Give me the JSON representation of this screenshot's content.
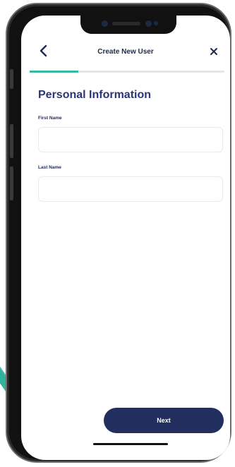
{
  "header": {
    "title": "Create New User",
    "back_icon": "chevron-left-icon",
    "close_icon": "close-icon"
  },
  "progress": {
    "step_fraction": 0.25
  },
  "form": {
    "section_title": "Personal Information",
    "first_name": {
      "label": "First Name",
      "value": "",
      "placeholder": ""
    },
    "last_name": {
      "label": "Last Name",
      "value": "",
      "placeholder": ""
    }
  },
  "actions": {
    "next_label": "Next"
  },
  "colors": {
    "accent": "#36b7a0",
    "primary": "#222f5e",
    "heading": "#2c3573"
  }
}
